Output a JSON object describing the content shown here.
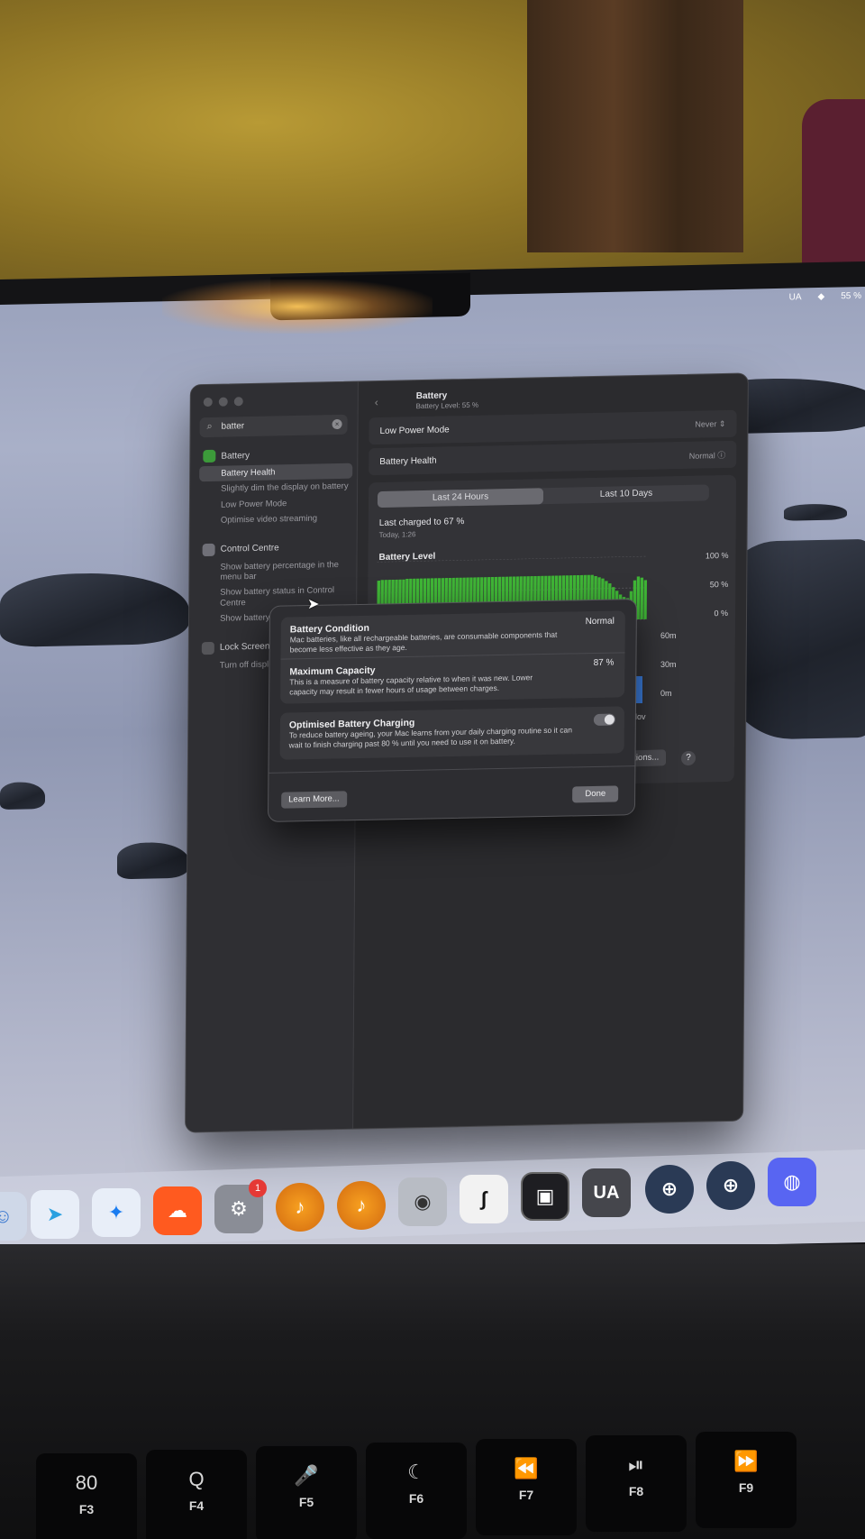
{
  "menubar": {
    "item1": "UA",
    "item2": "55 %"
  },
  "window": {
    "search_value": "batter",
    "sidebar": {
      "sections": [
        {
          "title": "Battery",
          "items": [
            "Battery Health",
            "Slightly dim the display on battery",
            "Low Power Mode",
            "Optimise video streaming"
          ]
        },
        {
          "title": "Control Centre",
          "items": [
            "Show battery percentage in the menu bar",
            "Show battery status in Control Centre",
            "Show battery in the menu bar"
          ]
        },
        {
          "title": "Lock Screen",
          "items": [
            "Turn off display when inactive"
          ]
        }
      ]
    },
    "title": "Battery",
    "subtitle": "Battery Level: 55 %",
    "low_power": {
      "label": "Low Power Mode",
      "value": "Never"
    },
    "health": {
      "label": "Battery Health",
      "value": "Normal"
    },
    "tabs": [
      "Last 24 Hours",
      "Last 10 Days"
    ],
    "last_charged": "Last charged to 67 %",
    "last_charged_time": "Today, 1:26",
    "level_label": "Battery Level",
    "level_ticks": [
      "100 %",
      "50 %",
      "0 %"
    ],
    "usage_ticks": [
      "60m",
      "30m",
      "0m"
    ],
    "date_fragment": "t. Nov",
    "options_label": "ptions...",
    "help_label": "?"
  },
  "modal": {
    "condition_title": "Battery Condition",
    "condition_value": "Normal",
    "condition_desc": "Mac batteries, like all rechargeable batteries, are consumable components that become less effective as they age.",
    "capacity_title": "Maximum Capacity",
    "capacity_value": "87 %",
    "capacity_desc": "This is a measure of battery capacity relative to when it was new. Lower capacity may result in fewer hours of usage between charges.",
    "optimised_title": "Optimised Battery Charging",
    "optimised_desc": "To reduce battery ageing, your Mac learns from your daily charging routine so it can wait to finish charging past 80 % until you need to use it on battery.",
    "learn_more": "Learn More...",
    "done": "Done"
  },
  "dock": {
    "badge_count": "1",
    "ua_label": "UA"
  },
  "keyboard": {
    "keys": [
      {
        "sym": "80",
        "fn": "F3"
      },
      {
        "sym": "Q",
        "fn": "F4"
      },
      {
        "sym": "🎤",
        "fn": "F5"
      },
      {
        "sym": "☾",
        "fn": "F6"
      },
      {
        "sym": "⏪",
        "fn": "F7"
      },
      {
        "sym": "⏯",
        "fn": "F8"
      },
      {
        "sym": "⏩",
        "fn": "F9"
      }
    ]
  },
  "colors": {
    "battery_green": "#3fb536",
    "usage_blue": "#3b7ddd",
    "badge_red": "#e53935"
  },
  "chart_data": {
    "type": "bar",
    "title": "Battery Level",
    "ylim": [
      0,
      100
    ],
    "y_ticks": [
      "100 %",
      "50 %",
      "0 %"
    ],
    "values": [
      70,
      71,
      71,
      71,
      71,
      71,
      71,
      71,
      72,
      72,
      72,
      72,
      72,
      72,
      72,
      72,
      72,
      72,
      72,
      72,
      72,
      72,
      72,
      72,
      72,
      72,
      72,
      72,
      72,
      72,
      72,
      72,
      72,
      72,
      72,
      72,
      72,
      72,
      72,
      72,
      72,
      72,
      72,
      72,
      72,
      72,
      72,
      72,
      72,
      72,
      72,
      72,
      72,
      72,
      72,
      72,
      72,
      72,
      72,
      72,
      72,
      70,
      68,
      66,
      62,
      58,
      52,
      46,
      40,
      36,
      34,
      45,
      62,
      68,
      66,
      62
    ]
  }
}
